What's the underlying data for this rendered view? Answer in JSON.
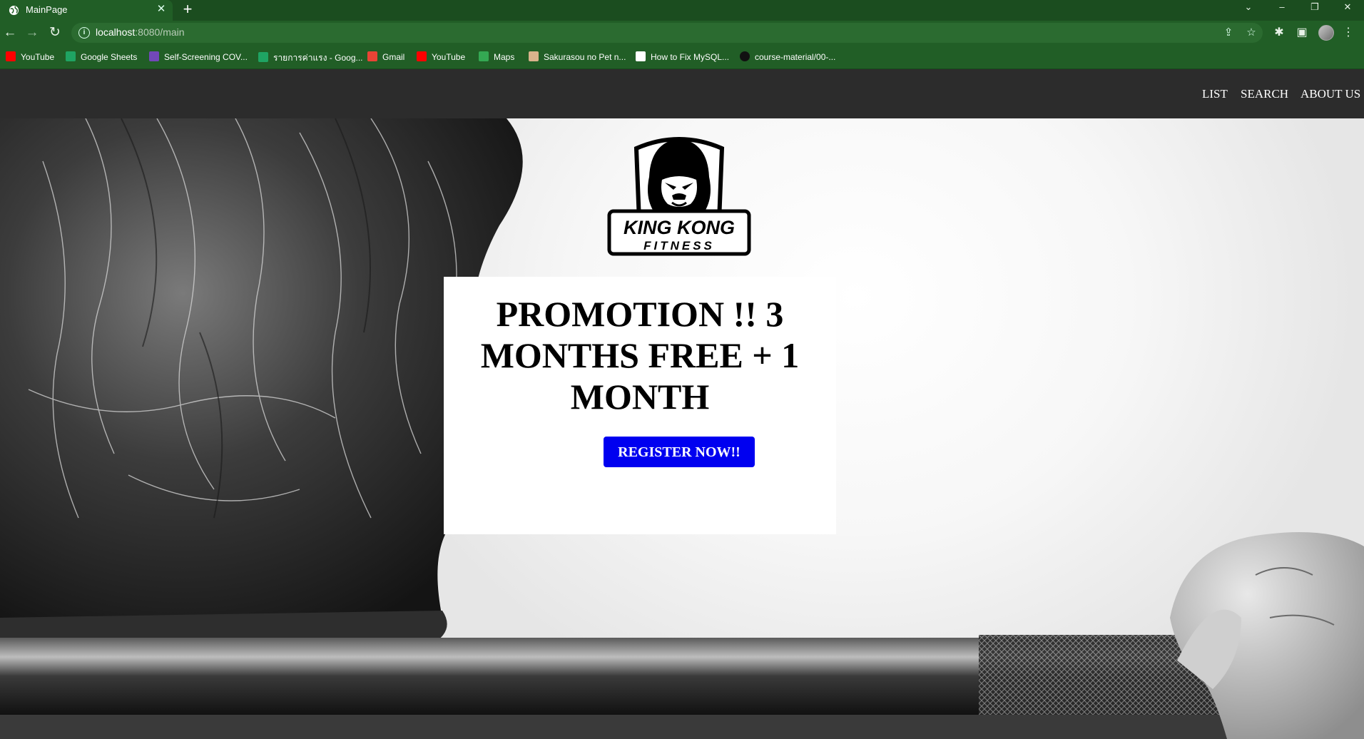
{
  "browser": {
    "tab_title": "MainPage",
    "url_host": "localhost",
    "url_rest": ":8080/main",
    "bookmarks": [
      {
        "label": "YouTube",
        "icon": "youtube-icon",
        "color": "#ff0000"
      },
      {
        "label": "Google Sheets",
        "icon": "sheets-icon",
        "color": "#1fa463"
      },
      {
        "label": "Self-Screening COV...",
        "icon": "forms-icon",
        "color": "#7248b9"
      },
      {
        "label": "รายการค่าแรง - Goog...",
        "icon": "sheets-icon",
        "color": "#1fa463"
      },
      {
        "label": "Gmail",
        "icon": "gmail-icon",
        "color": "#ea4335"
      },
      {
        "label": "YouTube",
        "icon": "youtube-icon",
        "color": "#ff0000"
      },
      {
        "label": "Maps",
        "icon": "maps-icon",
        "color": "#34a853"
      },
      {
        "label": "Sakurasou no Pet n...",
        "icon": "anime-icon",
        "color": "#d9b38c"
      },
      {
        "label": "How to Fix MySQL...",
        "icon": "doc-icon",
        "color": "#ffffff"
      },
      {
        "label": "course-material/00-...",
        "icon": "github-icon",
        "color": "#111111"
      }
    ]
  },
  "site": {
    "nav": [
      "LIST",
      "SEARCH",
      "ABOUT US"
    ],
    "logo_text": [
      "KING KONG",
      "FITNESS"
    ],
    "promo_heading": "PROMOTION !! 3 MONTHS FREE + 1 MONTH",
    "register_label": "REGISTER NOW!!"
  },
  "colors": {
    "chrome_dark": "#1b4d1f",
    "chrome": "#215e26",
    "site_nav_bg": "#2c2c2c",
    "register_button": "#0000f0"
  }
}
